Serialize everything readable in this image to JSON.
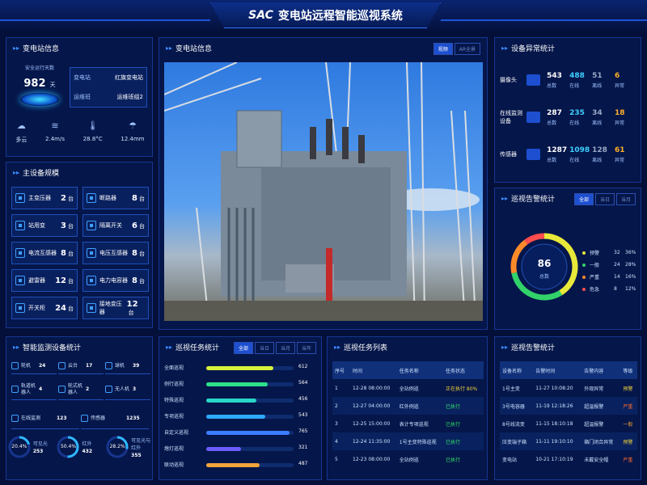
{
  "header": {
    "logo": "SAC",
    "title": "变电站远程智能巡视系统"
  },
  "station_info": {
    "title": "变电站信息",
    "days_label": "安全运行天数",
    "days_value": "982",
    "days_unit": "天",
    "station_label": "变电站",
    "station_value": "红旗变电站",
    "team_label": "运维班",
    "team_value": "运维班组2",
    "weather": [
      {
        "icon": "cloud-sun-icon",
        "value": "多云"
      },
      {
        "icon": "wind-icon",
        "value": "2.4m/s"
      },
      {
        "icon": "thermometer-icon",
        "value": "28.8°C"
      },
      {
        "icon": "rain-icon",
        "value": "12.4mm"
      }
    ]
  },
  "main_equipment": {
    "title": "主设备规模",
    "unit": "台",
    "items": [
      {
        "label": "主变压器",
        "value": "2"
      },
      {
        "label": "断路器",
        "value": "8"
      },
      {
        "label": "站用变",
        "value": "3"
      },
      {
        "label": "隔离开关",
        "value": "6"
      },
      {
        "label": "电流互感器",
        "value": "8"
      },
      {
        "label": "电压互感器",
        "value": "8"
      },
      {
        "label": "避雷器",
        "value": "12"
      },
      {
        "label": "电力电容器",
        "value": "8"
      },
      {
        "label": "开关柜",
        "value": "24"
      },
      {
        "label": "接地变压器",
        "value": "12"
      }
    ]
  },
  "video": {
    "title": "变电站信息",
    "tabs": [
      "视频",
      "AR全景"
    ],
    "active_tab": 0
  },
  "anomaly": {
    "title": "设备异常统计",
    "rows": [
      {
        "name": "摄像头",
        "total": "543",
        "online": "488",
        "offline": "51",
        "abnormal": "6"
      },
      {
        "name": "在线监测设备",
        "total": "287",
        "online": "235",
        "offline": "34",
        "abnormal": "18"
      },
      {
        "name": "传感器",
        "total": "1287",
        "online": "1098",
        "offline": "128",
        "abnormal": "61"
      }
    ],
    "labels": {
      "total": "总数",
      "online": "在线",
      "offline": "离线",
      "abnormal": "异常"
    }
  },
  "alarm_stats": {
    "title": "巡视告警统计",
    "tabs": [
      "全部",
      "当日",
      "当月"
    ],
    "active_tab": 0,
    "total": "86",
    "total_label": "总数",
    "items": [
      {
        "label": "预警",
        "count": "32",
        "pct": "36%",
        "color": "#e9e93a",
        "value": 32
      },
      {
        "label": "一般",
        "count": "24",
        "pct": "28%",
        "color": "#32d26a",
        "value": 24
      },
      {
        "label": "严重",
        "count": "14",
        "pct": "16%",
        "color": "#ff8a2a",
        "value": 14
      },
      {
        "label": "危急",
        "count": "8",
        "pct": "12%",
        "color": "#ff4d4d",
        "value": 8
      }
    ]
  },
  "smart_devices": {
    "title": "智能监测设备统计",
    "items": [
      {
        "label": "轮机",
        "value": "24"
      },
      {
        "label": "云台",
        "value": "17"
      },
      {
        "label": "球机",
        "value": "39"
      },
      {
        "label": "轨道机器人",
        "value": "4"
      },
      {
        "label": "轮式机器人",
        "value": "2"
      },
      {
        "label": "无人机",
        "value": "3"
      },
      {
        "label": "在线监测",
        "value": "123"
      },
      {
        "label": "传感器",
        "value": "1235"
      }
    ],
    "gauges": [
      {
        "pct": "20.4%",
        "label": "可见光",
        "value": "253",
        "fraction": 0.204
      },
      {
        "pct": "50.4%",
        "label": "红外",
        "value": "432",
        "fraction": 0.504
      },
      {
        "pct": "28.2%",
        "label": "可见光与红外",
        "value": "355",
        "fraction": 0.282
      }
    ]
  },
  "task_stats": {
    "title": "巡视任务统计",
    "tabs": [
      "全部",
      "当日",
      "当月",
      "当年"
    ],
    "active_tab": 0,
    "max": 800,
    "items": [
      {
        "label": "全面巡视",
        "value": "612",
        "n": 612,
        "color": "#d8f23a"
      },
      {
        "label": "例行巡视",
        "value": "564",
        "n": 564,
        "color": "#2ee08a"
      },
      {
        "label": "特殊巡视",
        "value": "456",
        "n": 456,
        "color": "#28d6c6"
      },
      {
        "label": "专项巡视",
        "value": "543",
        "n": 543,
        "color": "#2fa8ff"
      },
      {
        "label": "自定义巡视",
        "value": "765",
        "n": 765,
        "color": "#3d7dff"
      },
      {
        "label": "熄灯巡视",
        "value": "321",
        "n": 321,
        "color": "#6a5cff"
      },
      {
        "label": "联动巡视",
        "value": "487",
        "n": 487,
        "color": "#f3a43a"
      }
    ]
  },
  "task_list": {
    "title": "巡视任务列表",
    "columns": [
      "序号",
      "时间",
      "任务名称",
      "任务状态"
    ],
    "rows": [
      {
        "no": "1",
        "time": "12-28 08:00:00",
        "name": "全站例巡",
        "status": "正在执行 80%",
        "color": "#f3d43a"
      },
      {
        "no": "2",
        "time": "12-27 04:00:00",
        "name": "红外例巡",
        "status": "已执行",
        "color": "#32e06a"
      },
      {
        "no": "3",
        "time": "12-25 15:00:00",
        "name": "表计专项巡视",
        "status": "已执行",
        "color": "#32e06a"
      },
      {
        "no": "4",
        "time": "12-24 11:35:00",
        "name": "1号主变特殊巡视",
        "status": "已执行",
        "color": "#32e06a"
      },
      {
        "no": "5",
        "time": "12-23 08:00:00",
        "name": "全站例巡",
        "status": "已执行",
        "color": "#32e06a"
      }
    ]
  },
  "alarm_list": {
    "title": "巡视告警统计",
    "columns": [
      "设备名称",
      "告警时间",
      "告警内容",
      "等级"
    ],
    "rows": [
      {
        "device": "1号主变",
        "time": "11-27 10:08:20",
        "content": "外观异常",
        "level": "预警",
        "color": "#f3d43a"
      },
      {
        "device": "3号电容器",
        "time": "11-19 12:18:26",
        "content": "超温报警",
        "level": "严重",
        "color": "#ff6a2a"
      },
      {
        "device": "8号线流变",
        "time": "11-15 18:10:18",
        "content": "超温报警",
        "level": "一般",
        "color": "#f3a43a"
      },
      {
        "device": "压变端子箱",
        "time": "11-11 19:10:10",
        "content": "箱门闭合异常",
        "level": "预警",
        "color": "#f3d43a"
      },
      {
        "device": "变电站",
        "time": "10-21 17:10:19",
        "content": "未戴安全帽",
        "level": "严重",
        "color": "#ff6a2a"
      }
    ]
  }
}
